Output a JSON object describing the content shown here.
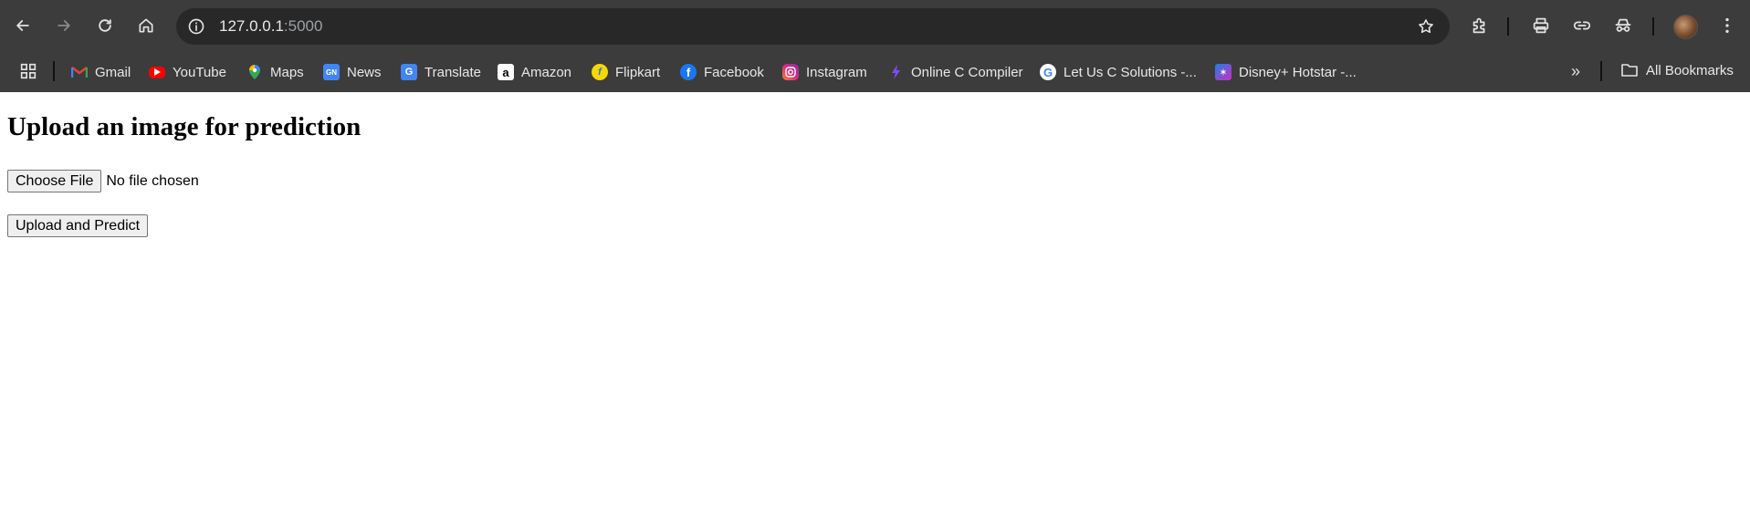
{
  "browser": {
    "url_host": "127.0.0.1",
    "url_port": ":5000",
    "icons": {
      "back": "arrow-left-icon",
      "forward": "arrow-right-icon",
      "reload": "reload-icon",
      "home": "home-icon",
      "site_info": "info-icon",
      "bookmark": "star-icon",
      "extensions": "puzzle-icon",
      "print": "printer-icon",
      "share": "link-icon",
      "incognito": "incognito-icon",
      "menu": "kebab-menu-icon"
    }
  },
  "bookmarks": {
    "items": [
      {
        "label": "Gmail",
        "icon": "gmail-icon",
        "color": "#EA4335"
      },
      {
        "label": "YouTube",
        "icon": "youtube-icon",
        "color": "#FF0000"
      },
      {
        "label": "Maps",
        "icon": "maps-icon",
        "color": "#34A853"
      },
      {
        "label": "News",
        "icon": "news-icon",
        "color": "#4285F4"
      },
      {
        "label": "Translate",
        "icon": "translate-icon",
        "color": "#4285F4"
      },
      {
        "label": "Amazon",
        "icon": "amazon-icon",
        "color": "#ffffff"
      },
      {
        "label": "Flipkart",
        "icon": "flipkart-icon",
        "color": "#F8D800"
      },
      {
        "label": "Facebook",
        "icon": "facebook-icon",
        "color": "#1877F2"
      },
      {
        "label": "Instagram",
        "icon": "instagram-icon",
        "color": "#E1306C"
      },
      {
        "label": "Online C Compiler",
        "icon": "compiler-icon",
        "color": "#7C4DFF"
      },
      {
        "label": "Let Us C Solutions -...",
        "icon": "google-icon",
        "color": "#ffffff"
      },
      {
        "label": "Disney+ Hotstar -...",
        "icon": "hotstar-icon",
        "color": "#1F80E0"
      }
    ],
    "more_icon": "chevron-double-right-icon",
    "all_bookmarks_label": "All Bookmarks"
  },
  "page": {
    "heading": "Upload an image for prediction",
    "choose_file_label": "Choose File",
    "file_status": "No file chosen",
    "submit_label": "Upload and Predict"
  }
}
